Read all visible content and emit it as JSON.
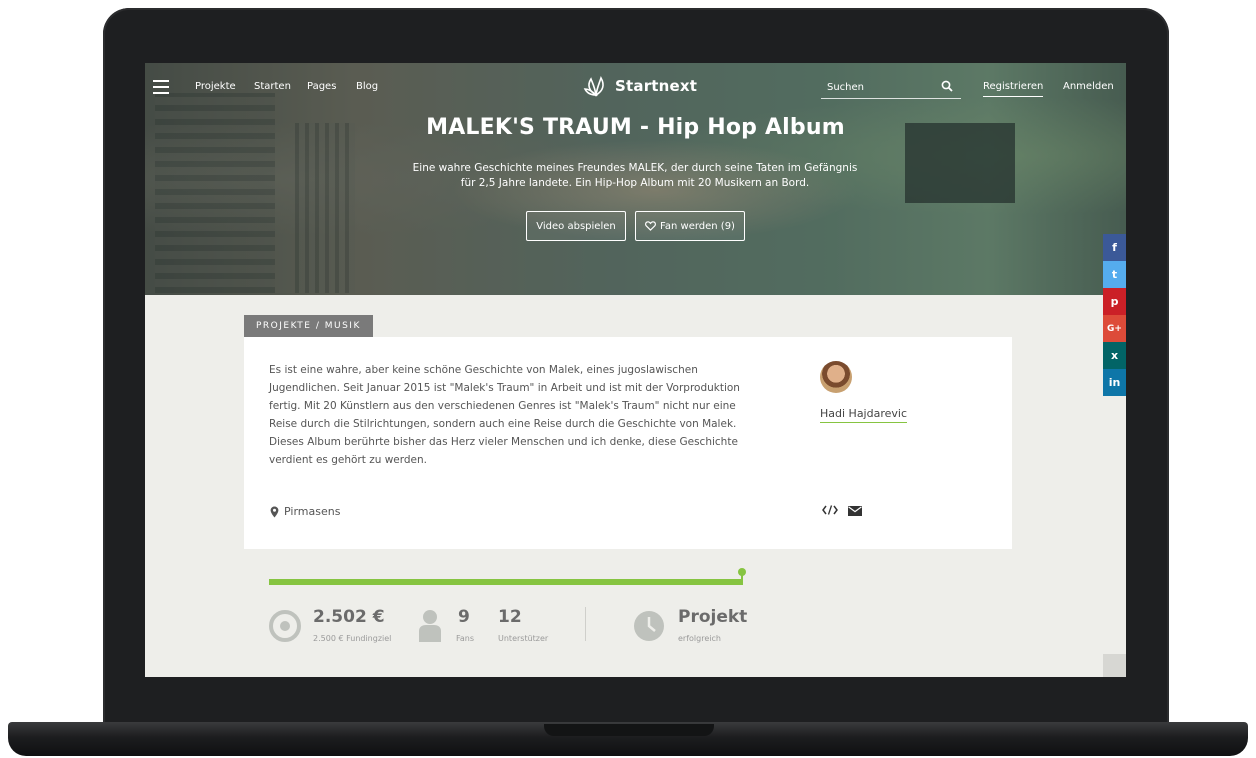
{
  "nav": {
    "links": [
      "Projekte",
      "Starten",
      "Pages",
      "Blog"
    ],
    "brand": "Startnext",
    "search_placeholder": "Suchen",
    "register": "Registrieren",
    "login": "Anmelden"
  },
  "hero": {
    "title": "MALEK'S TRAUM - Hip Hop Album",
    "subtitle_line1": "Eine wahre Geschichte meines Freundes MALEK, der durch seine Taten im Gefängnis",
    "subtitle_line2": "für 2,5 Jahre landete. Ein Hip-Hop Album mit 20 Musikern an Bord.",
    "video_button": "Video abspielen",
    "fan_button": "Fan werden (9)"
  },
  "social": {
    "items": [
      "f",
      "t",
      "p",
      "G+",
      "x",
      "in"
    ],
    "colors": [
      "#3b5998",
      "#55acee",
      "#cb2027",
      "#dd4b39",
      "#026466",
      "#0e76a8"
    ]
  },
  "project": {
    "category": "PROJEKTE / MUSIK",
    "description": "Es ist eine wahre, aber keine schöne Geschichte von Malek, eines jugoslawischen Jugendlichen. Seit Januar 2015 ist \"Malek's Traum\" in Arbeit und ist mit der Vorproduktion fertig. Mit 20 Künstlern aus den verschiedenen Genres ist \"Malek's Traum\" nicht nur eine Reise durch die Stilrichtungen, sondern auch eine Reise durch die Geschichte von Malek. Dieses Album berührte bisher das Herz vieler Menschen und ich denke, diese Geschichte verdient es gehört zu werden.",
    "location": "Pirmasens",
    "author": "Hadi Hajdarevic"
  },
  "stats": {
    "progress_percent": 100,
    "funded": "2.502 €",
    "funding_goal": "2.500 € Fundingziel",
    "fans": "9",
    "fans_label": "Fans",
    "supporters": "12",
    "supporters_label": "Unterstützer",
    "status": "Projekt",
    "status_label": "erfolgreich"
  },
  "colors": {
    "accent_green": "#86c441",
    "text_gray": "#555555"
  }
}
